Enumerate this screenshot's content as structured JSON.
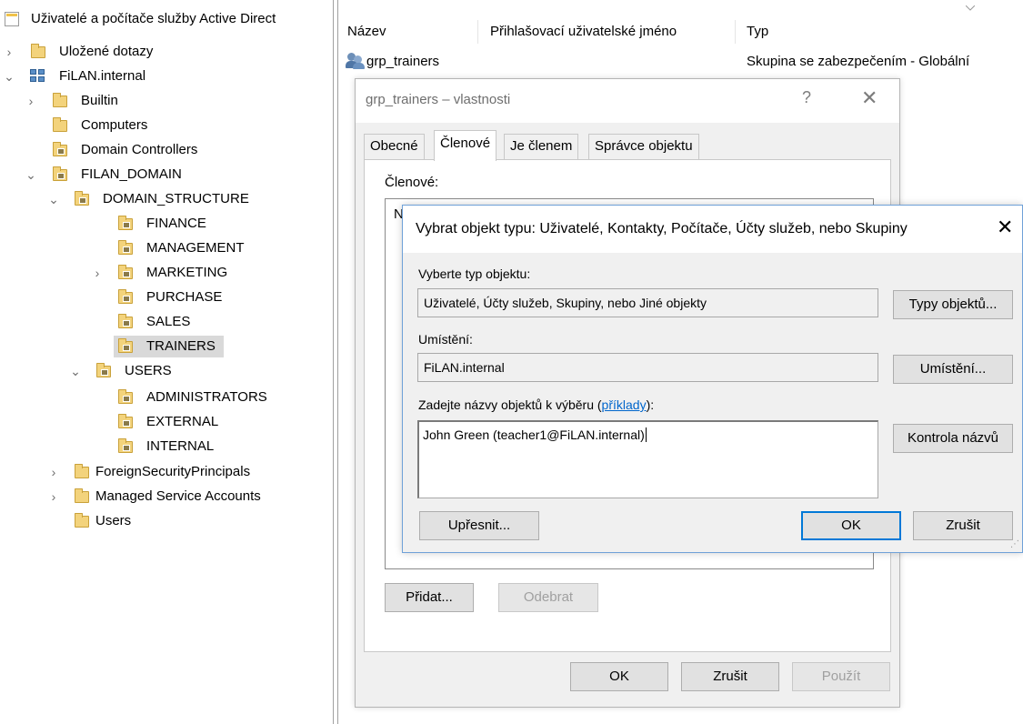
{
  "tree": {
    "root_label": "Uživatelé a počítače služby Active Direct",
    "items": [
      {
        "label": "Uložené dotazy"
      },
      {
        "label": "FiLAN.internal"
      },
      {
        "label": "Builtin"
      },
      {
        "label": "Computers"
      },
      {
        "label": "Domain Controllers"
      },
      {
        "label": "FILAN_DOMAIN"
      },
      {
        "label": "DOMAIN_STRUCTURE"
      },
      {
        "label": "FINANCE"
      },
      {
        "label": "MANAGEMENT"
      },
      {
        "label": "MARKETING"
      },
      {
        "label": "PURCHASE"
      },
      {
        "label": "SALES"
      },
      {
        "label": "TRAINERS"
      },
      {
        "label": "USERS"
      },
      {
        "label": "ADMINISTRATORS"
      },
      {
        "label": "EXTERNAL"
      },
      {
        "label": "INTERNAL"
      },
      {
        "label": "ForeignSecurityPrincipals"
      },
      {
        "label": "Managed Service Accounts"
      },
      {
        "label": "Users"
      }
    ],
    "selected": "TRAINERS"
  },
  "list": {
    "columns": [
      "Název",
      "Přihlašovací uživatelské jméno",
      "Typ"
    ],
    "rows": [
      {
        "name": "grp_trainers",
        "login": "",
        "type": "Skupina se zabezpečením - Globální"
      }
    ]
  },
  "props": {
    "title": "grp_trainers – vlastnosti",
    "help_glyph": "?",
    "close_glyph": "✕",
    "tabs": [
      "Obecné",
      "Členové",
      "Je členem",
      "Správce objektu"
    ],
    "active_tab": "Členové",
    "members_label": "Členové:",
    "members_col_fragment": "N",
    "add_button": "Přidat...",
    "remove_button": "Odebrat",
    "ok_button": "OK",
    "cancel_button": "Zrušit",
    "apply_button": "Použít"
  },
  "picker": {
    "title": "Vybrat objekt typu: Uživatelé, Kontakty, Počítače, Účty služeb, nebo Skupiny",
    "close_glyph": "✕",
    "object_type_label": "Vyberte typ objektu:",
    "object_type_value": "Uživatelé, Účty služeb, Skupiny, nebo Jiné objekty",
    "object_types_button": "Typy objektů...",
    "location_label": "Umístění:",
    "location_value": "FiLAN.internal",
    "location_button": "Umístění...",
    "names_label_prefix": "Zadejte názvy objektů k výběru (",
    "names_label_link": "příklady",
    "names_label_suffix": "):",
    "names_value": "John Green (teacher1@FiLAN.internal)",
    "check_names_button": "Kontrola názvů",
    "advanced_button": "Upřesnit...",
    "ok_button": "OK",
    "cancel_button": "Zrušit"
  }
}
